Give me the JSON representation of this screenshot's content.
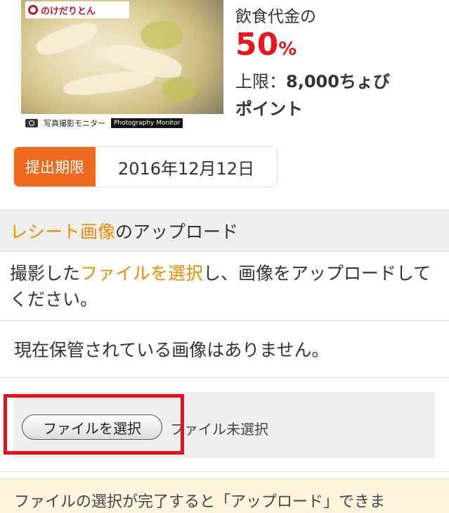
{
  "campaign": {
    "logo_text": "のけだりとん",
    "photo_strip_label": "写真撮影モニター",
    "photo_strip_en": "Photography Monitor"
  },
  "reward": {
    "label": "飲食代金の",
    "percent": "50",
    "percent_sign": "%",
    "limit_prefix": "上限：",
    "limit_value": "8,000ちょび",
    "points": "ポイント"
  },
  "deadline": {
    "tag": "提出期限",
    "date": "2016年12月12日"
  },
  "upload_section": {
    "title_highlight": "レシート画像",
    "title_rest": "のアップロード",
    "intro_pre": "撮影した",
    "intro_link": "ファイルを選択",
    "intro_post": "し、画像をアップロードしてください。",
    "stored_status": "現在保管されている画像はありません。"
  },
  "file_input": {
    "button_label": "ファイルを選択",
    "no_file_text": "ファイル未選択"
  },
  "notice": {
    "text": "ファイルの選択が完了すると「アップロード」できま"
  },
  "colors": {
    "accent_orange": "#f08c00",
    "deadline_tag": "#f06a1e",
    "percent_red": "#e8171f",
    "highlight_red": "#e0141e"
  }
}
